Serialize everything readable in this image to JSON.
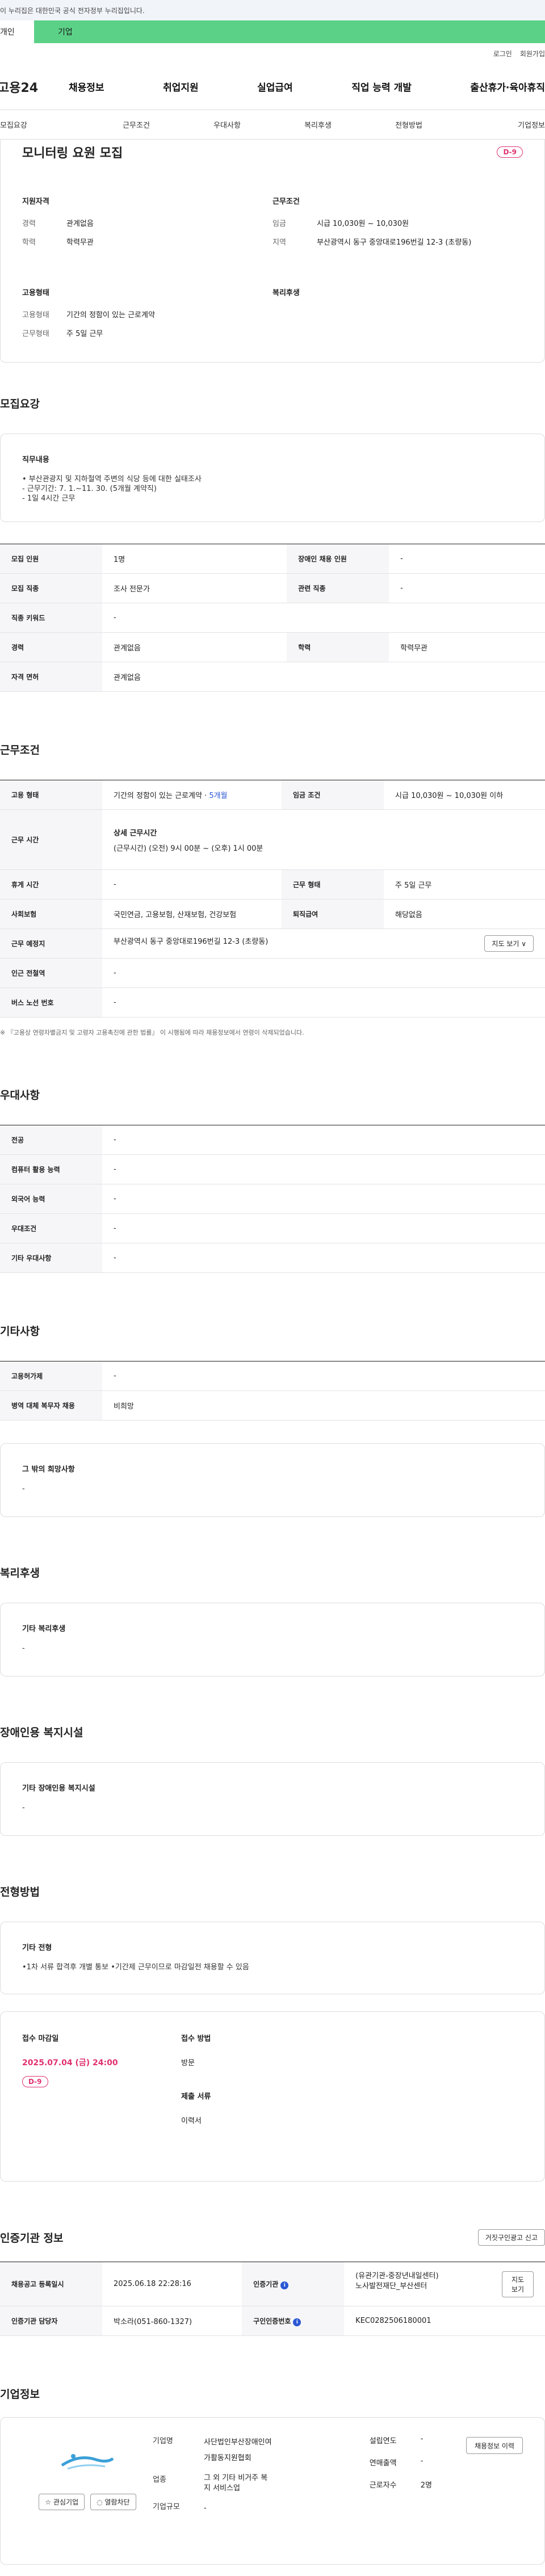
{
  "gov_notice": "이 누리집은 대한민국 공식 전자정부 누리집입니다.",
  "tabs": {
    "personal": "개인",
    "company": "기업"
  },
  "util": {
    "login": "로그인",
    "signup": "회원가입"
  },
  "logo": "고용24",
  "gnb": [
    "채용정보",
    "취업지원",
    "실업급여",
    "직업 능력 개발",
    "출산휴가·육아휴직"
  ],
  "anchors": [
    "모집요강",
    "근무조건",
    "우대사항",
    "복리후생",
    "전형방법",
    "기업정보"
  ],
  "summary": {
    "title": "모니터링 요원 모집",
    "dday": "D-9",
    "qual_head": "지원자격",
    "qual": [
      {
        "k": "경력",
        "v": "관계없음"
      },
      {
        "k": "학력",
        "v": "학력무관"
      }
    ],
    "cond_head": "근무조건",
    "cond": [
      {
        "k": "임금",
        "v": "시급 10,030원 ~ 10,030원"
      },
      {
        "k": "지역",
        "v": "부산광역시 동구 중앙대로196번길 12-3 (초량동)"
      }
    ],
    "emp_head": "고용형태",
    "emp": [
      {
        "k": "고용형태",
        "v": "기간의 정함이 있는 근로계약"
      },
      {
        "k": "근무형태",
        "v": "주 5일 근무"
      }
    ],
    "welfare_head": "복리후생"
  },
  "recruit": {
    "title": "모집요강",
    "duty_head": "직무내용",
    "duty_lines": [
      "• 부산관광지 및 지하철역 주변의 식당 등에 대한 실태조사",
      "- 근무기간: 7. 1.~11. 30. (5개월 계약직)",
      "- 1일 4시간 근무"
    ],
    "rows": [
      {
        "k1": "모집 인원",
        "v1": "1명",
        "k2": "장애인 채용 인원",
        "v2": "-"
      },
      {
        "k1": "모집 직종",
        "v1": "조사 전문가",
        "k2": "관련 직종",
        "v2": "-"
      },
      {
        "k1": "직종 키워드",
        "v1": "-"
      },
      {
        "k1": "경력",
        "v1": "관계없음",
        "k2": "학력",
        "v2": "학력무관"
      },
      {
        "k1": "자격 면허",
        "v1": "관계없음"
      }
    ]
  },
  "work": {
    "title": "근무조건",
    "emp_k": "고용 형태",
    "emp_v": "기간의 정함이 있는 근로계약 · ",
    "emp_v_blue": "5개월",
    "wage_k": "임금 조건",
    "wage_v": "시급 10,030원 ~ 10,030원 이하",
    "hours_k": "근무 시간",
    "hours_head": "상세 근무시간",
    "hours_v": "(근무시간) (오전) 9시 00분 ~ (오후) 1시 00분",
    "rest_k": "휴게 시간",
    "rest_v": "-",
    "form_k": "근무 형태",
    "form_v": "주 5일 근무",
    "ins_k": "사회보험",
    "ins_v": "국민연금, 고용보험, 산재보험, 건강보험",
    "sev_k": "퇴직급여",
    "sev_v": "해당없음",
    "place_k": "근무 예정지",
    "place_v": "부산광역시 동구 중앙대로196번길 12-3 (초량동)",
    "map_btn": "지도 보기 ∨",
    "station_k": "인근 전철역",
    "station_v": "-",
    "bus_k": "버스 노선 번호",
    "bus_v": "-",
    "note": "※ 『고용상 연령차별금지 및 고령자 고용촉진에 관한 법률』 이 시행됨에 따라 채용정보에서 연령이 삭제되었습니다."
  },
  "pref": {
    "title": "우대사항",
    "rows": [
      {
        "k": "전공",
        "v": "-"
      },
      {
        "k": "컴퓨터 활용 능력",
        "v": "-"
      },
      {
        "k": "외국어 능력",
        "v": "-"
      },
      {
        "k": "우대조건",
        "v": "-"
      },
      {
        "k": "기타 우대사항",
        "v": "-"
      }
    ]
  },
  "etc": {
    "title": "기타사항",
    "rows": [
      {
        "k": "고용허가제",
        "v": "-"
      },
      {
        "k": "병역 대체 복무자 채용",
        "v": "비희망"
      }
    ],
    "card_head": "그 밖의 희망사항",
    "card_v": "-"
  },
  "welfare": {
    "title": "복리후생",
    "card_head": "기타 복리후생",
    "card_v": "-"
  },
  "disab": {
    "title": "장애인용 복지시설",
    "card_head": "기타 장애인용 복지시설",
    "card_v": "-"
  },
  "screening": {
    "title": "전형방법",
    "card_head": "기타 전형",
    "card_v": "•1차 서류 합격후 개별 통보 •기간제 근무이므로 마감일전 채용할 수 있음",
    "deadline_head": "접수 마감일",
    "deadline": "2025.07.04 (금) 24:00",
    "dday": "D-9",
    "method_head": "접수 방법",
    "method_v": "방문",
    "docs_head": "제출 서류",
    "docs_v": "이력서"
  },
  "cert": {
    "title": "인증기관 정보",
    "report_btn": "거짓구인광고 신고",
    "reg_k": "채용공고 등록일시",
    "reg_v": "2025.06.18 22:28:16",
    "agency_k": "인증기관",
    "agency_v": "(유관기관-중장년내일센터) 노사발전재단_부산센터",
    "agency_btn": "지도 보기",
    "staff_k": "인증기관 담당자",
    "staff_v": "박소라(051-860-1327)",
    "num_k": "구인인증번호",
    "num_v": "KEC0282506180001"
  },
  "company": {
    "title": "기업정보",
    "fav_btn": "☆ 관심기업",
    "block_btn": "◌ 열람차단",
    "name_k": "기업명",
    "name_v": "사단법인부산장애인여가활동지원협회",
    "ind_k": "업종",
    "ind_v": "그 외 기타 비거주 복지 서비스업",
    "size_k": "기업규모",
    "size_v": "-",
    "year_k": "설립연도",
    "year_v": "-",
    "sales_k": "연매출액",
    "sales_v": "-",
    "emp_k": "근로자수",
    "emp_v": "2명",
    "info_btn": "채용정보 이력"
  }
}
